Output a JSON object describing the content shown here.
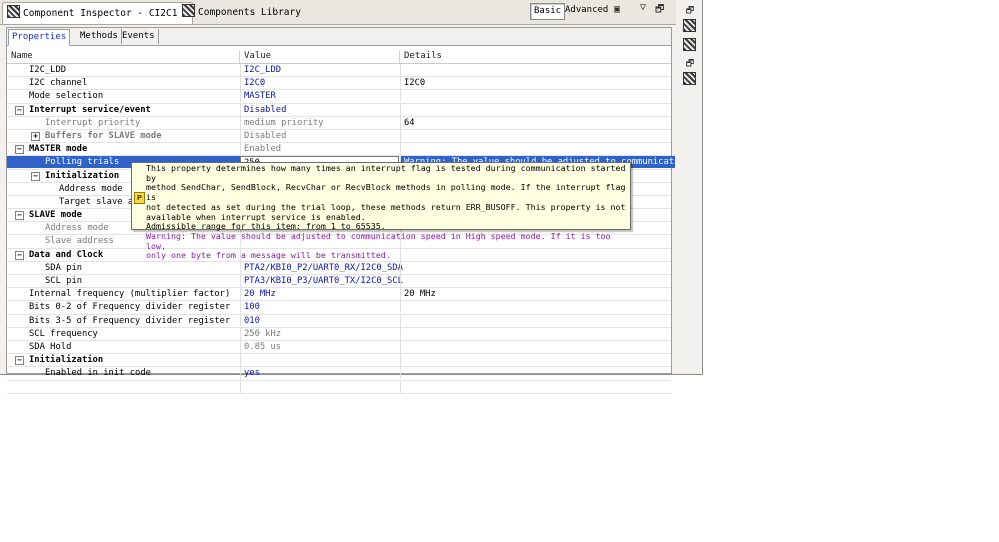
{
  "tabs": {
    "inspector_label": "Component Inspector - CI2C1",
    "library_label": "Components Library"
  },
  "toolbar": {
    "basic_label": "Basic",
    "advanced_label": "Advanced"
  },
  "subtabs": {
    "properties": "Properties",
    "methods": "Methods",
    "events": "Events"
  },
  "columns": {
    "name": "Name",
    "value": "Value",
    "details": "Details"
  },
  "rows": [
    {
      "name": "I2C_LDD",
      "value": "I2C_LDD",
      "details": ""
    },
    {
      "name": "I2C channel",
      "value": "I2C0",
      "details": "I2C0"
    },
    {
      "name": "Mode selection",
      "value": "MASTER",
      "details": ""
    },
    {
      "name": "Interrupt service/event",
      "value": "Disabled",
      "details": ""
    },
    {
      "name": "Interrupt priority",
      "value": "medium priority",
      "details": "64"
    },
    {
      "name": "Buffers for SLAVE mode",
      "value": "Disabled",
      "details": ""
    },
    {
      "name": "MASTER mode",
      "value": "Enabled",
      "details": ""
    },
    {
      "name": "Polling trials",
      "value": "250",
      "details": "Warning: The value should be adjusted to communication"
    },
    {
      "name": "Initialization",
      "value": "",
      "details": ""
    },
    {
      "name": "Address mode",
      "value": "",
      "details": ""
    },
    {
      "name": "Target slave ad",
      "value": "",
      "details": ""
    },
    {
      "name": "SLAVE mode",
      "value": "",
      "details": ""
    },
    {
      "name": "Address mode",
      "value": "",
      "details": ""
    },
    {
      "name": "Slave address",
      "value": "",
      "details": ""
    },
    {
      "name": "Data and Clock",
      "value": "",
      "details": ""
    },
    {
      "name": "SDA pin",
      "value": "PTA2/KBI0_P2/UART0_RX/I2C0_SDA",
      "details": ""
    },
    {
      "name": "SCL pin",
      "value": "PTA3/KBI0_P3/UART0_TX/I2C0_SCL",
      "details": ""
    },
    {
      "name": "Internal frequency (multiplier factor)",
      "value": "20 MHz",
      "details": "20 MHz"
    },
    {
      "name": "Bits 0-2 of Frequency divider register",
      "value": "100",
      "details": ""
    },
    {
      "name": "Bits 3-5 of Frequency divider register",
      "value": "010",
      "details": ""
    },
    {
      "name": "SCL frequency",
      "value": "250 kHz",
      "details": ""
    },
    {
      "name": "SDA Hold",
      "value": "0.85 us",
      "details": ""
    },
    {
      "name": "Initialization",
      "value": "",
      "details": ""
    },
    {
      "name": "Enabled in init code",
      "value": "yes",
      "details": ""
    }
  ],
  "tooltip": {
    "line1": "This property determines how many times an interrupt flag is tested during communication started by",
    "line2": "method SendChar, SendBlock, RecvChar or RecvBlock methods in polling mode. If the interrupt flag is",
    "line3": "not detected as set during the trial loop, these methods return ERR_BUSOFF. This property is not",
    "line4": "available when interrupt service is enabled.",
    "line5": "Admissible range for this item: from 1 to 65535.",
    "warn1": "Warning: The value should be adjusted to communication speed in High speed mode. If it is too low,",
    "warn2": "only one byte from a message will be transmitted."
  },
  "icons": {
    "component_tab": "component-icon",
    "library_tab": "library-icon",
    "close": "close-icon",
    "view_menu": "view-menu-icon",
    "minimize": "minimize-icon",
    "maximize": "maximize-icon",
    "tooltip_marker": "property-info-icon"
  }
}
